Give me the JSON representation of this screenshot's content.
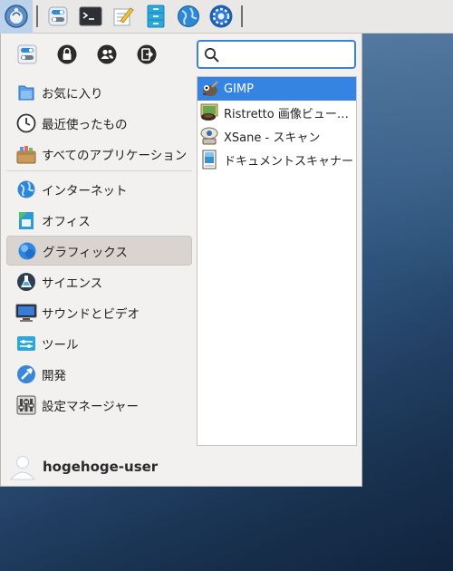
{
  "panel": {
    "items": [
      "menu-button",
      "settings",
      "terminal",
      "text-editor",
      "file-manager",
      "web-browser",
      "settings-manager"
    ]
  },
  "menu": {
    "toolbar": {
      "buttons": [
        "settings-icon",
        "lock-icon",
        "switch-user-icon",
        "logout-icon"
      ]
    },
    "search": {
      "value": "",
      "placeholder": ""
    },
    "categories": [
      {
        "label": "お気に入り",
        "icon": "favorites-icon"
      },
      {
        "label": "最近使ったもの",
        "icon": "recent-icon"
      },
      {
        "label": "すべてのアプリケーション",
        "icon": "all-apps-icon"
      },
      {
        "label": "インターネット",
        "icon": "internet-icon"
      },
      {
        "label": "オフィス",
        "icon": "office-icon"
      },
      {
        "label": "グラフィックス",
        "icon": "graphics-icon",
        "selected": true
      },
      {
        "label": "サイエンス",
        "icon": "science-icon"
      },
      {
        "label": "サウンドとビデオ",
        "icon": "multimedia-icon"
      },
      {
        "label": "ツール",
        "icon": "tools-icon"
      },
      {
        "label": "開発",
        "icon": "development-icon"
      },
      {
        "label": "設定マネージャー",
        "icon": "settings-manager-icon"
      }
    ],
    "apps": [
      {
        "label": "GIMP",
        "icon": "gimp-icon",
        "selected": true
      },
      {
        "label": "Ristretto 画像ビュー…",
        "icon": "ristretto-icon"
      },
      {
        "label": "XSane - スキャン",
        "icon": "xsane-icon"
      },
      {
        "label": "ドキュメントスキャナー",
        "icon": "document-scanner-icon"
      }
    ],
    "user": {
      "name": "hogehoge-user"
    }
  },
  "colors": {
    "accent": "#3584e4",
    "selection_category": "#d9d4cf",
    "panel": "#e9e8e6"
  }
}
